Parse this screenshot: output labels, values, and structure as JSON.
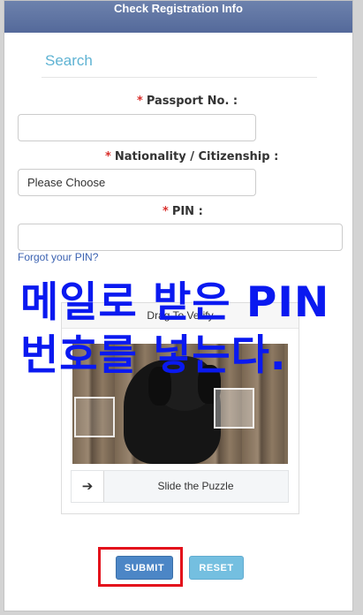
{
  "header": {
    "title": "Check Registration Info"
  },
  "search": {
    "title": "Search"
  },
  "form": {
    "required_mark": "*",
    "passport_label": "Passport No. :",
    "passport_value": "",
    "nationality_label": "Nationality / Citizenship :",
    "nationality_selected": "Please Choose",
    "pin_label": "PIN :",
    "pin_value": "",
    "forgot_pin": "Forgot your PIN?"
  },
  "overlay": {
    "line1": "메일로 받은 PIN",
    "line2": "번호를 넣는다."
  },
  "captcha": {
    "title": "Drag To Verify",
    "slider_text": "Slide the Puzzle",
    "slider_icon": "arrow-right-icon"
  },
  "buttons": {
    "submit": "SUBMIT",
    "reset": "RESET"
  },
  "colors": {
    "header": "#5a6fa0",
    "search_title": "#5fb3d3",
    "required": "#d9302c",
    "overlay_text": "#0a19f0",
    "submit": "#4c86c6",
    "reset": "#74bfe0",
    "highlight": "#e3101b"
  }
}
